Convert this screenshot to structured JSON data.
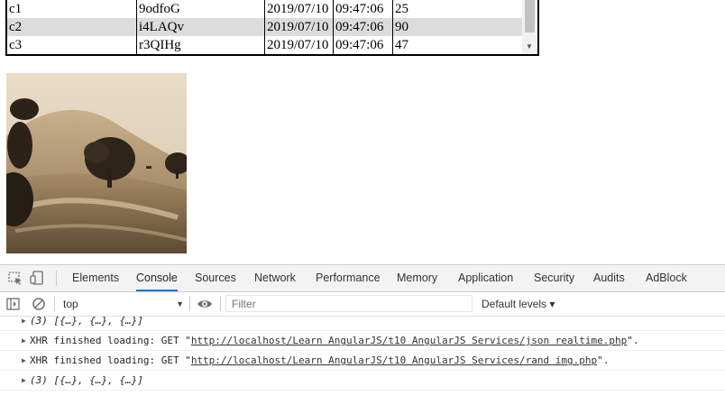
{
  "table": {
    "rows": [
      {
        "id": "c1",
        "code": "9odfoG",
        "date": "2019/07/10",
        "time": "09:47:06",
        "value": "25"
      },
      {
        "id": "c2",
        "code": "i4LAQv",
        "date": "2019/07/10",
        "time": "09:47:06",
        "value": "90"
      },
      {
        "id": "c3",
        "code": "r3QIHg",
        "date": "2019/07/10",
        "time": "09:47:06",
        "value": "47"
      }
    ]
  },
  "devtools": {
    "tabs": [
      "Elements",
      "Console",
      "Sources",
      "Network",
      "Performance",
      "Memory",
      "Application",
      "Security",
      "Audits",
      "AdBlock"
    ],
    "active_tab": "Console",
    "context": "top",
    "filter_placeholder": "Filter",
    "levels": "Default levels ▾",
    "logs": [
      {
        "text": "(3) [{…}, {…}, {…}]",
        "italic": true
      },
      {
        "prefix": "XHR finished loading: GET \"",
        "link": "http://localhost/Learn AngularJS/t10 AngularJS Services/json realtime.php",
        "suffix": "\"."
      },
      {
        "prefix": "XHR finished loading: GET \"",
        "link": "http://localhost/Learn AngularJS/t10 AngularJS Services/rand img.php",
        "suffix": "\"."
      },
      {
        "text": "(3) [{…}, {…}, {…}]",
        "italic": true
      }
    ]
  },
  "colors": {
    "active_tab_underline": "#1a73e8",
    "photo_tone": "sepia"
  }
}
